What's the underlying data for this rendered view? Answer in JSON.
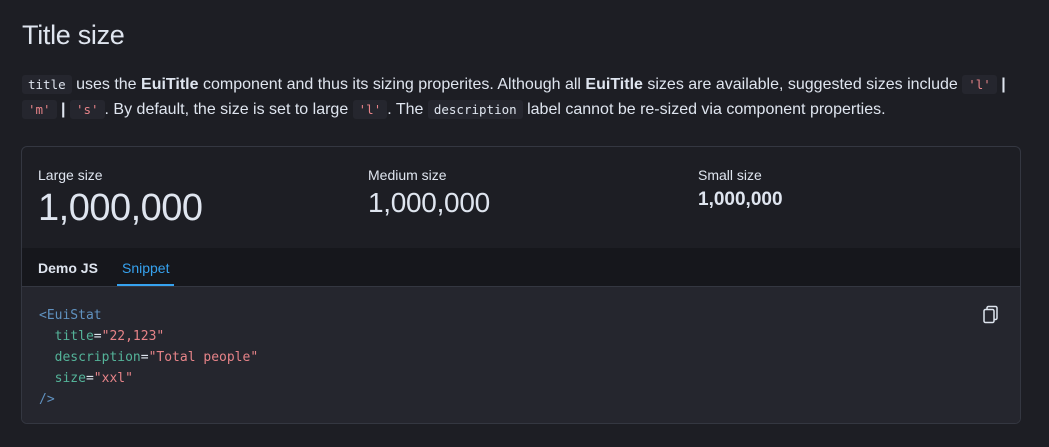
{
  "heading": "Title size",
  "description": {
    "code_title": "title",
    "t1": " uses the ",
    "b1": "EuiTitle",
    "t2": " component and thus its sizing properites. Although all ",
    "b2": "EuiTitle",
    "t3": " sizes are available, suggested sizes include ",
    "size_l": "'l'",
    "sep1": " | ",
    "size_m": "'m'",
    "sep2": " | ",
    "size_s": "'s'",
    "t4": ". By default, the size is set to large ",
    "size_default": "'l'",
    "t5": ". The ",
    "code_description": "description",
    "t6": " label cannot be re-sized via component properties."
  },
  "stats": [
    {
      "label": "Large size",
      "value": "1,000,000"
    },
    {
      "label": "Medium size",
      "value": "1,000,000"
    },
    {
      "label": "Small size",
      "value": "1,000,000"
    }
  ],
  "tabs": [
    {
      "label": "Demo JS",
      "selected": false
    },
    {
      "label": "Snippet",
      "selected": true
    }
  ],
  "snippet": {
    "open_tag": "<EuiStat",
    "attrs": [
      {
        "name": "title",
        "value": "\"22,123\""
      },
      {
        "name": "description",
        "value": "\"Total people\""
      },
      {
        "name": "size",
        "value": "\"xxl\""
      }
    ],
    "close_tag": "/>"
  },
  "icons": {
    "copy": "copy-icon"
  },
  "colors": {
    "accent": "#36a2ef",
    "background": "#1d1e24",
    "code_bg": "#25262e"
  }
}
